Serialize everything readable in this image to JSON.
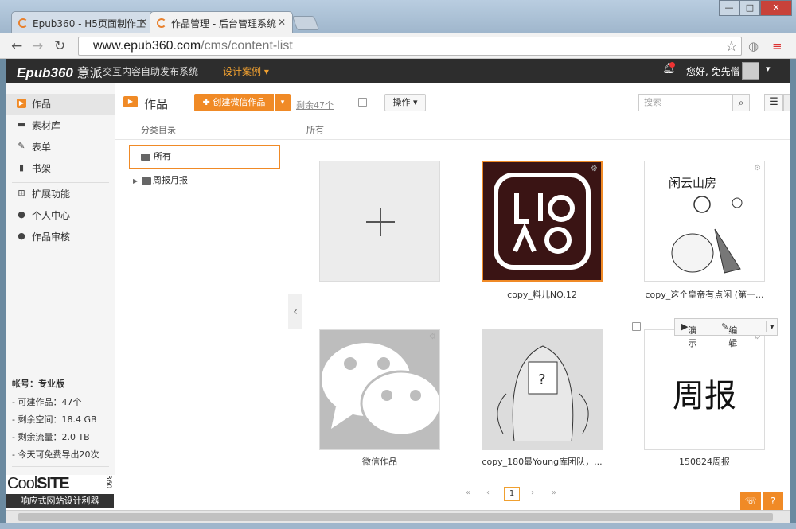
{
  "browser": {
    "tabs": [
      {
        "label": "Epub360 - H5页面制作工"
      },
      {
        "label": "作品管理 - 后台管理系统"
      }
    ],
    "url_host": "www.epub360.com",
    "url_path": "/cms/content-list",
    "window_controls": {
      "minimize": "—",
      "maximize": "□",
      "close": "✕"
    }
  },
  "appbar": {
    "logo": "Epub360",
    "logo_suffix": "意派",
    "system_name": "交互内容自助发布系统",
    "design_cases": "设计案例 ▾",
    "greeting": "您好, 免先僧",
    "caret": "▾"
  },
  "sidebar": {
    "items": [
      {
        "label": "作品",
        "icon": "play-icon"
      },
      {
        "label": "素材库",
        "icon": "folder-icon"
      },
      {
        "label": "表单",
        "icon": "edit-icon"
      },
      {
        "label": "书架",
        "icon": "book-icon"
      },
      {
        "label": "扩展功能",
        "icon": "sitemap-icon"
      },
      {
        "label": "个人中心",
        "icon": "user-icon"
      },
      {
        "label": "作品审核",
        "icon": "user-icon"
      }
    ],
    "account": {
      "title": "帐号：专业版",
      "lines": [
        "- 可建作品：47个",
        "- 剩余空间：18.4 GB",
        "- 剩余流量：2.0 TB",
        "- 今天可免费导出20次"
      ]
    },
    "promo": {
      "brand_light": "Cool",
      "brand_bold": "SITE",
      "brand_num": "360",
      "tagline": "响应式网站设计利器"
    }
  },
  "main": {
    "title": "作品",
    "create_button": "✚ 创建微信作品",
    "create_dropdown": "▾",
    "remaining": "剩余47个",
    "operation_button": "操作 ▾",
    "search_placeholder": "搜索",
    "category_header": "分类目录",
    "all_header": "所有",
    "tree": {
      "selected": "所有",
      "child": "周报月报"
    },
    "cards": [
      {
        "label": "",
        "kind": "add"
      },
      {
        "label": "copy_料儿NO.12",
        "kind": "liao"
      },
      {
        "label": "copy_这个皇帝有点闲 (第一...",
        "kind": "sketch",
        "img_text": "闲云山房"
      },
      {
        "label": "微信作品",
        "kind": "wechat"
      },
      {
        "label": "copy_180最Young库团队，...",
        "kind": "comic"
      },
      {
        "label": "150824周报",
        "kind": "text",
        "img_text": "周报"
      }
    ],
    "hover_actions": {
      "demo": "演示",
      "edit": "编辑"
    },
    "pager": {
      "first": "«",
      "prev": "‹",
      "page": "1",
      "next": "›",
      "last": "»"
    },
    "float_buttons": [
      "☏",
      "?"
    ]
  }
}
